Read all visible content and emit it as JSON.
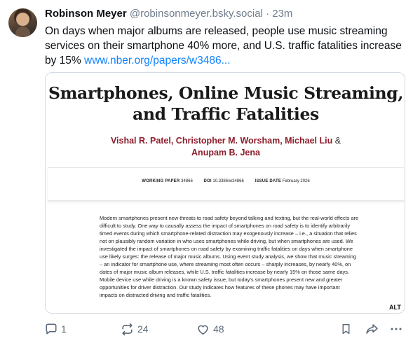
{
  "post": {
    "author_name": "Robinson Meyer",
    "author_handle": "@robinsonmeyer.bsky.social",
    "separator": "·",
    "time": "23m",
    "text": "On days when major albums are released, people use music streaming services on their smartphone 40% more, and U.S. traffic fatalities increase by 15% ",
    "link_text": "www.nber.org/papers/w3486..."
  },
  "embed": {
    "title": "Smartphones, Online Music Streaming, and Traffic Fatalities",
    "authors": "Vishal R. Patel, Christopher M. Worsham, Michael Liu",
    "authors_amp": "&",
    "authors_last": "Anupam B. Jena",
    "working_paper_label": "WORKING PAPER",
    "working_paper_value": "34866",
    "doi_label": "DOI",
    "doi_value": "10.3386/w34866",
    "issue_date_label": "ISSUE DATE",
    "issue_date_value": "February 2026",
    "abstract": "Modern smartphones present new threats to road safety beyond talking and texting, but the real-world effects are difficult to study. One way to causally assess the impact of smartphones on road safety is to identify arbitrarily timed events during which smartphone-related distraction may exogenously increase – i.e., a situation that relies not on plausibly random variation in who uses smartphones while driving, but when smartphones are used. We investigated the impact of smartphones on road safety by examining traffic fatalities on days when smartphone use likely surges: the release of major music albums. Using event study analysis, we show that music streaming – an indicator for smartphone use, where streaming most often occurs – sharply increases, by nearly 40%, on dates of major music album releases, while U.S. traffic fatalities increase by nearly 15% on those same days. Mobile device use while driving is a known safety issue, but today's smartphones present new and greater opportunities for driver distraction. Our study indicates how features of these phones may have important impacts on distracted driving and traffic fatalities.",
    "alt_badge": "ALT"
  },
  "actions": {
    "reply_count": "1",
    "repost_count": "24",
    "like_count": "48"
  },
  "icons": {
    "reply": "reply-icon",
    "repost": "repost-icon",
    "like": "heart-icon",
    "bookmark": "bookmark-icon",
    "share": "share-icon",
    "more": "more-icon"
  },
  "colors": {
    "link": "#1083fe",
    "author_name_in_paper": "#8c1d2b",
    "muted": "#6f7c8c"
  }
}
